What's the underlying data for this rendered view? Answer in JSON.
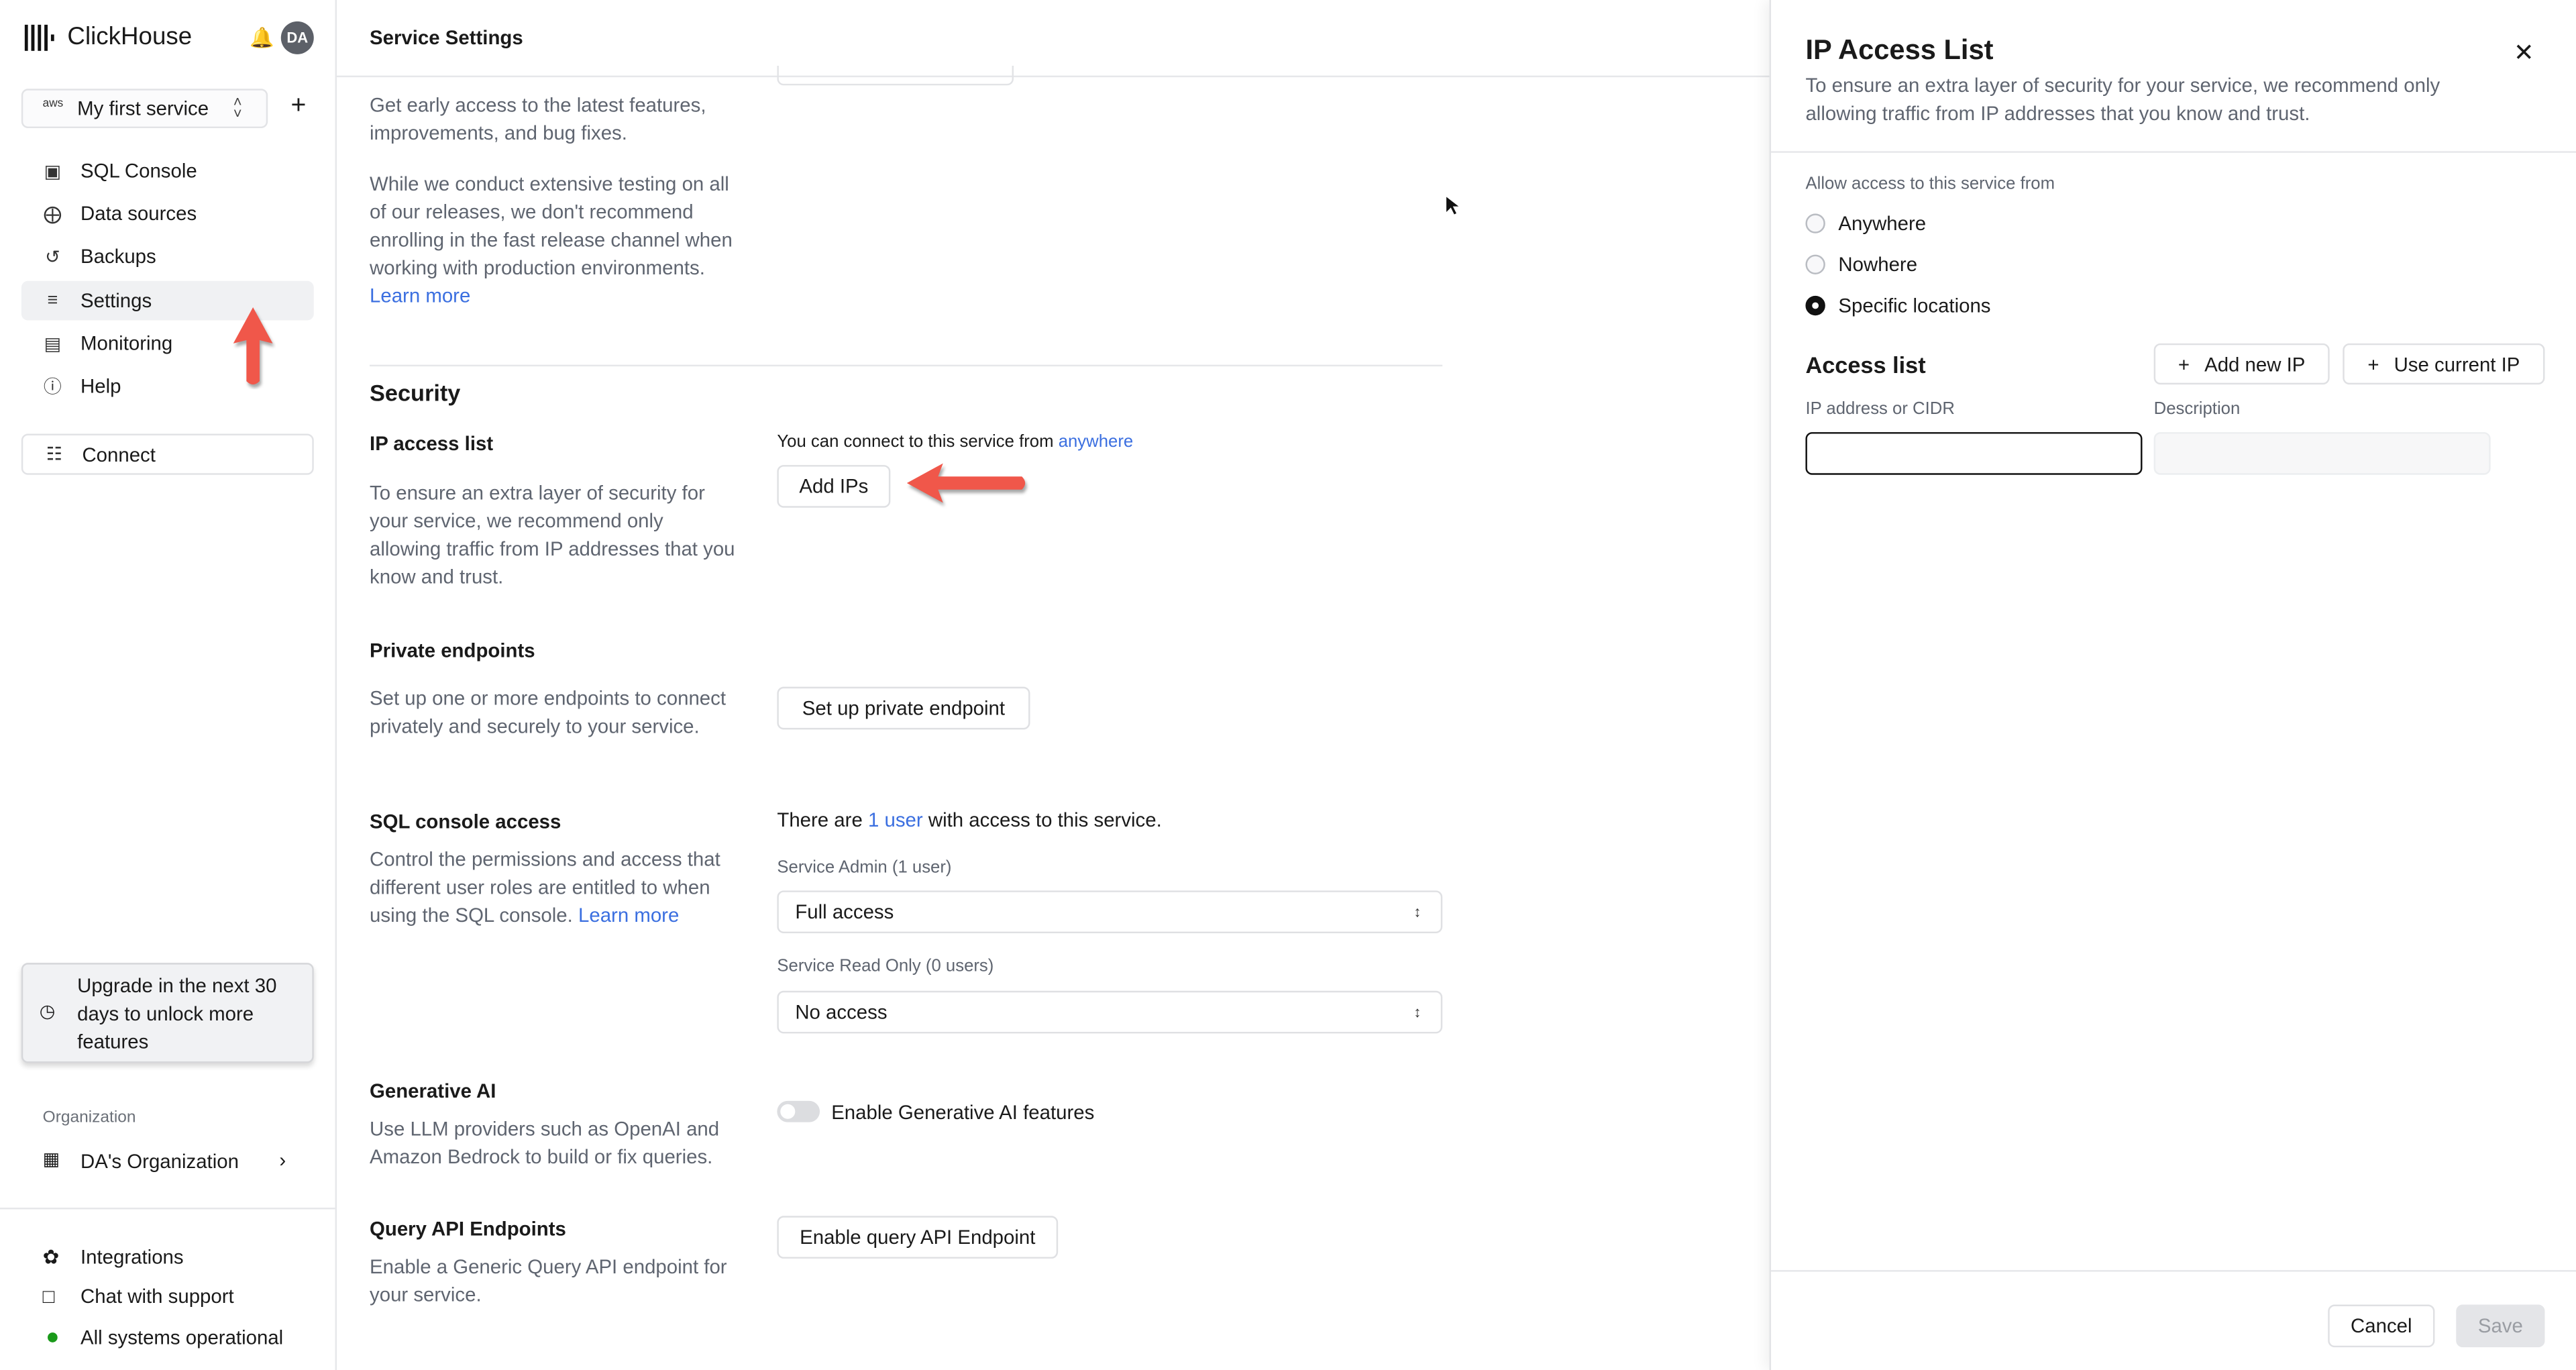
{
  "sidebar": {
    "brand": "ClickHouse",
    "avatar": "DA",
    "service_provider": "aws",
    "service_name": "My first service",
    "nav": [
      {
        "label": "SQL Console",
        "icon": "monitor-icon"
      },
      {
        "label": "Data sources",
        "icon": "data-sources-icon"
      },
      {
        "label": "Backups",
        "icon": "backup-icon"
      },
      {
        "label": "Settings",
        "icon": "sliders-icon",
        "selected": true
      },
      {
        "label": "Monitoring",
        "icon": "chart-icon"
      },
      {
        "label": "Help",
        "icon": "help-icon"
      }
    ],
    "connect": "Connect",
    "upgrade": "Upgrade in the next 30 days to unlock more features",
    "org_section": "Organization",
    "org_name": "DA's Organization",
    "footer": {
      "integrations": "Integrations",
      "chat": "Chat with support",
      "status": "All systems operational",
      "status_color": "#1a9a1a"
    }
  },
  "main": {
    "title": "Service Settings",
    "release": {
      "desc1": "Get early access to the latest features, improvements, and bug fixes.",
      "desc2": "While we conduct extensive testing on all of our releases, we don't recommend enrolling in the fast release channel when working with production environments.",
      "learn_more": "Learn more"
    },
    "security_heading": "Security",
    "ip_access": {
      "title": "IP access list",
      "desc": "To ensure an extra layer of security for your service, we recommend only allowing traffic from IP addresses that you know and trust.",
      "status_prefix": "You can connect to this service from",
      "status_link": "anywhere",
      "button": "Add IPs"
    },
    "private_endpoints": {
      "title": "Private endpoints",
      "desc": "Set up one or more endpoints to connect privately and securely to your service.",
      "button": "Set up private endpoint"
    },
    "sql_console": {
      "title": "SQL console access",
      "desc": "Control the permissions and access that different user roles are entitled to when using the SQL console.",
      "learn_more": "Learn more",
      "status_prefix": "There are",
      "status_link": "1 user",
      "status_suffix": "with access to this service.",
      "admin_label": "Service Admin (1 user)",
      "admin_value": "Full access",
      "readonly_label": "Service Read Only (0 users)",
      "readonly_value": "No access"
    },
    "gen_ai": {
      "title": "Generative AI",
      "desc": "Use LLM providers such as OpenAI and Amazon Bedrock to build or fix queries.",
      "toggle_label": "Enable Generative AI features",
      "enabled": false
    },
    "query_api": {
      "title": "Query API Endpoints",
      "desc": "Enable a Generic Query API endpoint for your service.",
      "button": "Enable query API Endpoint"
    }
  },
  "panel": {
    "title": "IP Access List",
    "desc": "To ensure an extra layer of security for your service, we recommend only allowing traffic from IP addresses that you know and trust.",
    "allow_label": "Allow access to this service from",
    "options": [
      {
        "label": "Anywhere",
        "checked": false
      },
      {
        "label": "Nowhere",
        "checked": false
      },
      {
        "label": "Specific locations",
        "checked": true
      }
    ],
    "access_list_heading": "Access list",
    "add_new_ip": "Add new IP",
    "use_current_ip": "Use current IP",
    "ip_label": "IP address or CIDR",
    "ip_value": "",
    "desc_label": "Description",
    "desc_value": "",
    "cancel": "Cancel",
    "save": "Save"
  },
  "annotation_color": "#f0574a"
}
